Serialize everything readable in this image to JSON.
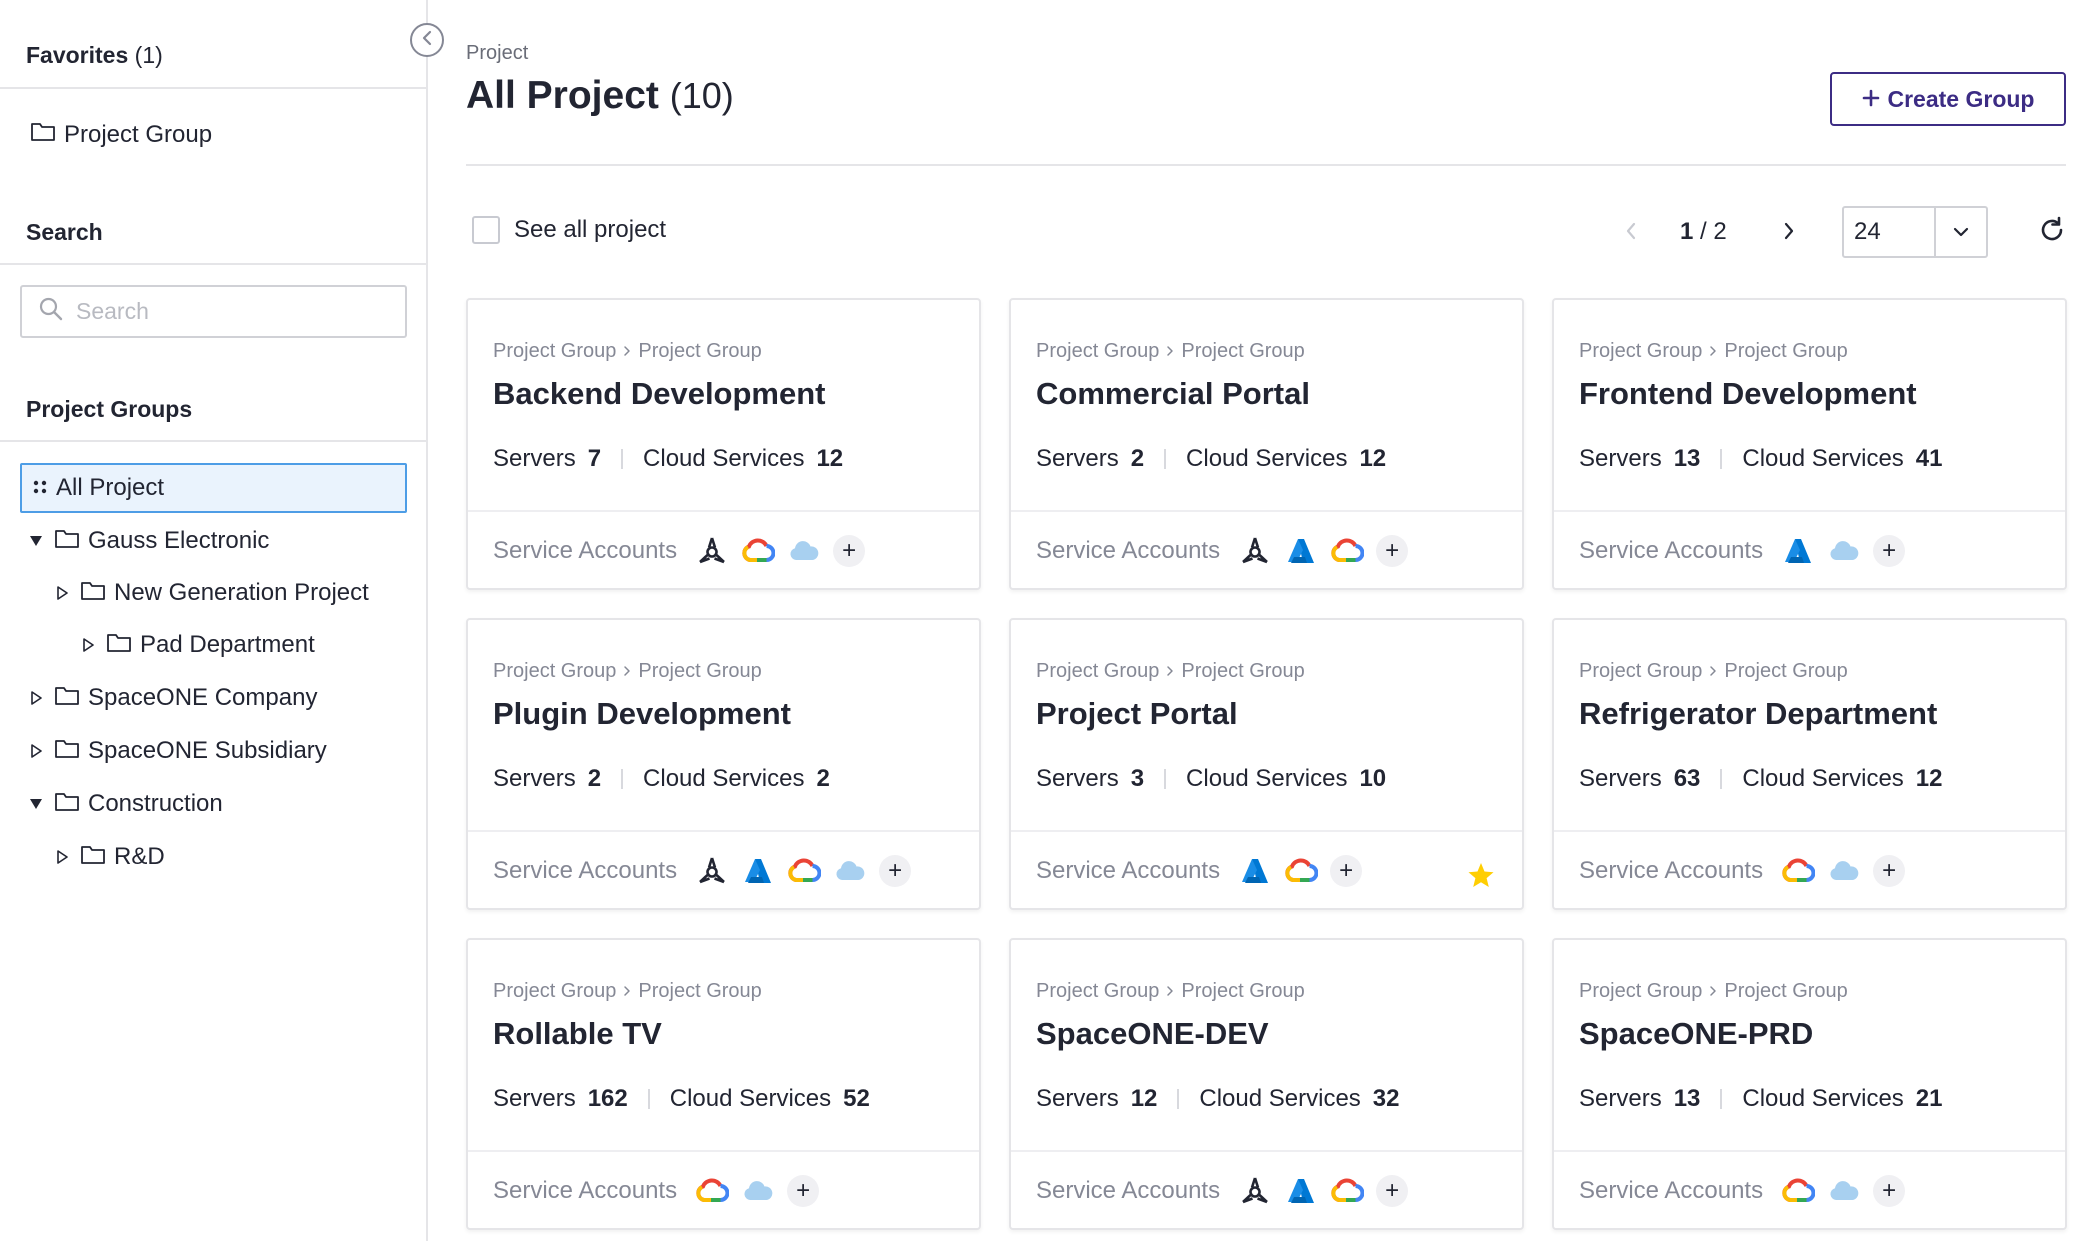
{
  "sidebar": {
    "favorites_title": "Favorites",
    "favorites_count": "(1)",
    "favorites": [
      {
        "label": "Project Group"
      }
    ],
    "search_title": "Search",
    "search_placeholder": "Search",
    "groups_title": "Project Groups",
    "tree": [
      {
        "label": "All Project",
        "selected": true,
        "icon": "grid-icon"
      },
      {
        "label": "Gauss Electronic",
        "expanded": true
      },
      {
        "label": "New Generation Project",
        "expanded": false
      },
      {
        "label": "Pad Department",
        "expanded": false
      },
      {
        "label": "SpaceONE Company",
        "expanded": false
      },
      {
        "label": "SpaceONE Subsidiary",
        "expanded": false
      },
      {
        "label": "Construction",
        "expanded": true
      },
      {
        "label": "R&D",
        "expanded": false
      }
    ]
  },
  "header": {
    "breadcrumb": "Project",
    "title": "All Project",
    "count": "(10)",
    "create_label": "Create Group"
  },
  "toolbar": {
    "see_all_label": "See all project",
    "page_current": "1",
    "page_sep": "/",
    "page_total": "2",
    "page_size": "24"
  },
  "card_labels": {
    "crumb_parent": "Project Group",
    "crumb_child": "Project Group",
    "servers": "Servers",
    "cloud_services": "Cloud Services",
    "service_accounts": "Service Accounts"
  },
  "projects": [
    {
      "name": "Backend Development",
      "servers": "7",
      "cloud_services": "12",
      "providers": [
        "openstack",
        "google",
        "cloud"
      ],
      "favorite": false
    },
    {
      "name": "Commercial Portal",
      "servers": "2",
      "cloud_services": "12",
      "providers": [
        "openstack",
        "azure",
        "google"
      ],
      "favorite": false
    },
    {
      "name": "Frontend Development",
      "servers": "13",
      "cloud_services": "41",
      "providers": [
        "azure",
        "cloud"
      ],
      "favorite": false
    },
    {
      "name": "Plugin Development",
      "servers": "2",
      "cloud_services": "2",
      "providers": [
        "openstack",
        "azure",
        "google",
        "cloud"
      ],
      "favorite": false
    },
    {
      "name": "Project Portal",
      "servers": "3",
      "cloud_services": "10",
      "providers": [
        "azure",
        "google"
      ],
      "favorite": true
    },
    {
      "name": "Refrigerator Department",
      "servers": "63",
      "cloud_services": "12",
      "providers": [
        "google",
        "cloud"
      ],
      "favorite": false
    },
    {
      "name": "Rollable TV",
      "servers": "162",
      "cloud_services": "52",
      "providers": [
        "google",
        "cloud"
      ],
      "favorite": false
    },
    {
      "name": "SpaceONE-DEV",
      "servers": "12",
      "cloud_services": "32",
      "providers": [
        "openstack",
        "azure",
        "google"
      ],
      "favorite": false
    },
    {
      "name": "SpaceONE-PRD",
      "servers": "13",
      "cloud_services": "21",
      "providers": [
        "google",
        "cloud"
      ],
      "favorite": false
    }
  ],
  "colors": {
    "accent": "#3c2c84",
    "selected_bg": "#eaf3fd",
    "selected_border": "#4d9de6",
    "star": "#ffce02",
    "azure": "#0078d4",
    "cloud": "#a8d0f0"
  }
}
